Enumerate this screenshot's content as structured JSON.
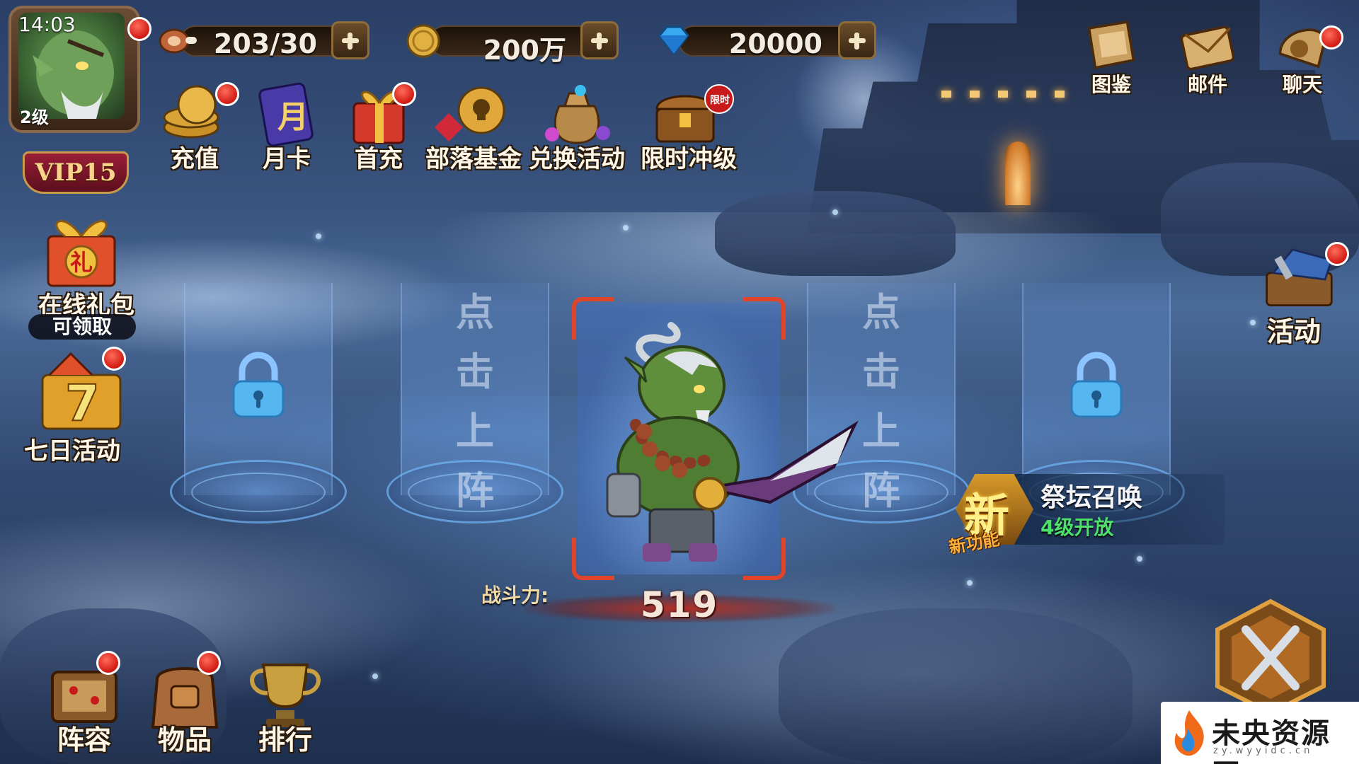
{
  "status": {
    "time": "14:03",
    "player_level": "2级",
    "vip": "VIP15"
  },
  "resources": {
    "stamina": "203/30",
    "gold": "200万",
    "diamonds": "20000"
  },
  "top_menu": [
    {
      "label": "充值",
      "icon": "coin-stack-icon",
      "badge": true
    },
    {
      "label": "月卡",
      "icon": "month-card-icon",
      "badge": false
    },
    {
      "label": "首充",
      "icon": "gift-box-icon",
      "badge": true
    },
    {
      "label": "部落基金",
      "icon": "skull-coin-icon",
      "badge": false
    },
    {
      "label": "兑换活动",
      "icon": "treasure-bag-icon",
      "badge": false
    },
    {
      "label": "限时冲级",
      "icon": "treasure-chest-icon",
      "badge": false,
      "tag": "限时"
    }
  ],
  "top_right_menu": [
    {
      "label": "图鉴",
      "icon": "codex-icon",
      "badge": false
    },
    {
      "label": "邮件",
      "icon": "mail-icon",
      "badge": false
    },
    {
      "label": "聊天",
      "icon": "chat-horn-icon",
      "badge": true
    }
  ],
  "left_menu": {
    "online_gift": {
      "label": "在线礼包",
      "status": "可领取",
      "icon_text": "礼"
    },
    "seven_day": {
      "label": "七日活动",
      "icon_text": "7"
    }
  },
  "right_menu": {
    "activity": {
      "label": "活动"
    }
  },
  "formation": {
    "empty_slot_text": [
      "点",
      "击",
      "上",
      "阵"
    ],
    "power_label": "战斗力:",
    "power_value": "519"
  },
  "feature_unlock": {
    "badge": "新",
    "tag": "新功能",
    "title": "祭坛召唤",
    "requirement": "4级开放"
  },
  "bottom_menu": [
    {
      "label": "阵容",
      "icon": "formation-icon",
      "badge": true
    },
    {
      "label": "物品",
      "icon": "backpack-icon",
      "badge": true
    },
    {
      "label": "排行",
      "icon": "trophy-icon",
      "badge": false
    }
  ],
  "watermark": {
    "text": "未央资源网",
    "url": "zy.wyyidc.cn"
  },
  "colors": {
    "badge_red": "#d11a14",
    "frame_red": "#e0452c",
    "unlock_green": "#4ee06a"
  }
}
